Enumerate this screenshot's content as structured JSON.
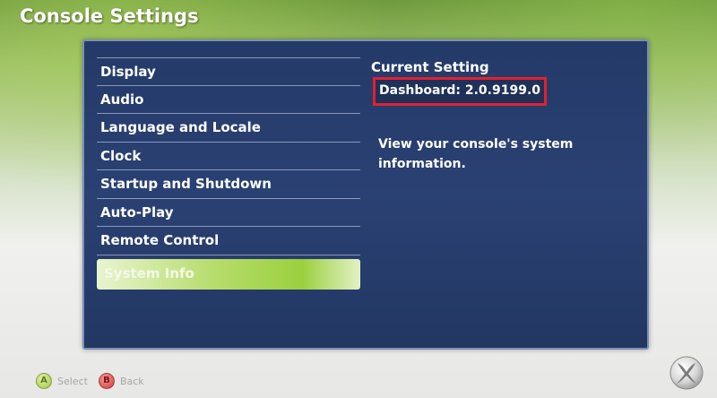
{
  "header": {
    "title": "Console Settings"
  },
  "menu": {
    "items": [
      {
        "label": "Display"
      },
      {
        "label": "Audio"
      },
      {
        "label": "Language and Locale"
      },
      {
        "label": "Clock"
      },
      {
        "label": "Startup and Shutdown"
      },
      {
        "label": "Auto-Play"
      },
      {
        "label": "Remote Control"
      },
      {
        "label": "System Info",
        "selected": true
      }
    ]
  },
  "details": {
    "current_setting_label": "Current Setting",
    "current_value": "Dashboard: 2.0.9199.0",
    "description": "View your console's system information."
  },
  "controls": [
    {
      "glyph": "A",
      "label": "Select",
      "icon": "a-button-icon",
      "color": "#9cc43e"
    },
    {
      "glyph": "B",
      "label": "Back",
      "icon": "b-button-icon",
      "color": "#d0322e"
    }
  ],
  "colors": {
    "panel": "#2a4173",
    "highlight": "#e4202d",
    "selection": "#9bd03e"
  },
  "logo": {
    "icon": "xbox-logo-icon"
  }
}
